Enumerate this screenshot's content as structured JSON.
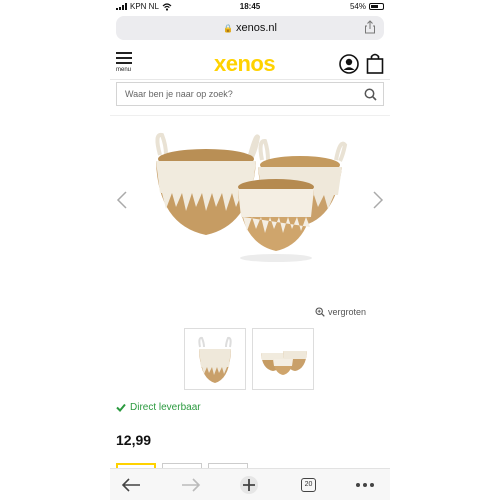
{
  "status": {
    "carrier": "KPN NL",
    "time": "18:45",
    "battery": "54%"
  },
  "browser": {
    "host": "xenos.nl"
  },
  "header": {
    "menu_label": "menu",
    "logo": "xenos"
  },
  "search": {
    "placeholder": "Waar ben je naar op zoek?"
  },
  "product": {
    "zoom_label": "vergroten",
    "stock_text": "Direct leverbaar",
    "price": "12,99"
  },
  "toolbar": {
    "tab_count": "20"
  },
  "colors": {
    "brand_yellow": "#ffd200",
    "stock_green": "#2b9a3f"
  },
  "icons": [
    "menu-icon",
    "user-icon",
    "bag-icon",
    "search-icon",
    "chevron-left-icon",
    "chevron-right-icon",
    "zoom-icon",
    "check-icon",
    "back-arrow-icon",
    "forward-arrow-icon",
    "plus-icon",
    "tabs-icon",
    "more-icon",
    "share-icon",
    "lock-icon",
    "wifi-icon"
  ]
}
